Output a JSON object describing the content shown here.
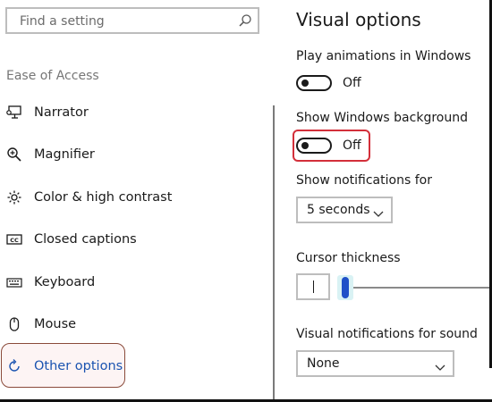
{
  "search": {
    "placeholder": "Find a setting",
    "icon": "search-icon"
  },
  "sidebar": {
    "heading": "Ease of Access",
    "items": [
      {
        "label": "Narrator",
        "icon": "narrator-icon"
      },
      {
        "label": "Magnifier",
        "icon": "magnifier-icon"
      },
      {
        "label": "Color & high contrast",
        "icon": "brightness-icon"
      },
      {
        "label": "Closed captions",
        "icon": "closed-captions-icon"
      },
      {
        "label": "Keyboard",
        "icon": "keyboard-icon"
      },
      {
        "label": "Mouse",
        "icon": "mouse-icon"
      },
      {
        "label": "Other options",
        "icon": "other-options-icon",
        "selected": true
      }
    ]
  },
  "main": {
    "title": "Visual options",
    "play_animations": {
      "label": "Play animations in Windows",
      "state": "Off"
    },
    "show_background": {
      "label": "Show Windows background",
      "state": "Off"
    },
    "notifications": {
      "label": "Show notifications for",
      "value": "5 seconds"
    },
    "cursor_thickness": {
      "label": "Cursor thickness",
      "level": 1
    },
    "visual_notifications": {
      "label": "Visual notifications for sound",
      "value": "None"
    }
  },
  "colors": {
    "accent": "#1f50c8",
    "selected_text": "#1a53b0",
    "highlight_outline": "#d32f3a"
  }
}
